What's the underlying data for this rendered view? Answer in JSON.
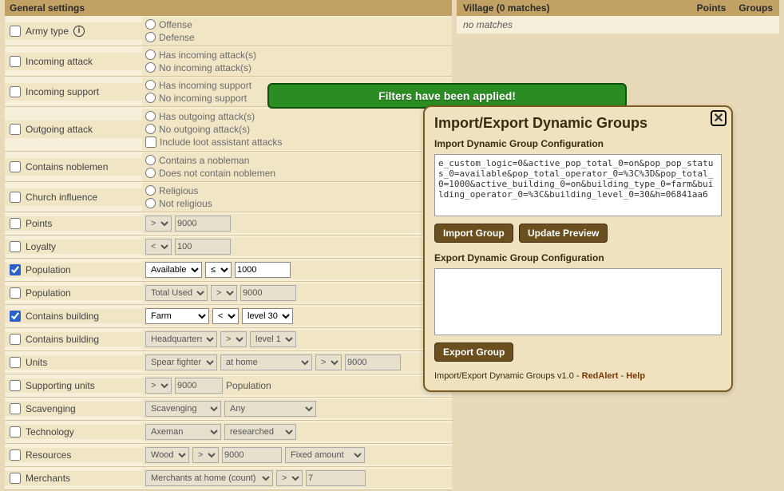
{
  "header": {
    "general_settings": "General settings"
  },
  "villages": {
    "col_village": "Village (0 matches)",
    "col_points": "Points",
    "col_groups": "Groups",
    "no_matches": "no matches"
  },
  "filters": {
    "army_type": {
      "label": "Army type",
      "offense": "Offense",
      "defense": "Defense"
    },
    "incoming_attack": {
      "label": "Incoming attack",
      "o1": "Has incoming attack(s)",
      "o2": "No incoming attack(s)"
    },
    "incoming_support": {
      "label": "Incoming support",
      "o1": "Has incoming support",
      "o2": "No incoming support"
    },
    "outgoing_attack": {
      "label": "Outgoing attack",
      "o1": "Has outgoing attack(s)",
      "o2": "No outgoing attack(s)",
      "o3": "Include loot assistant attacks"
    },
    "contains_noblemen": {
      "label": "Contains noblemen",
      "o1": "Contains a nobleman",
      "o2": "Does not contain noblemen"
    },
    "church_influence": {
      "label": "Church influence",
      "o1": "Religious",
      "o2": "Not religious"
    },
    "points": {
      "label": "Points",
      "op": ">",
      "val": "9000"
    },
    "loyalty": {
      "label": "Loyalty",
      "op": "<",
      "val": "100"
    },
    "population1": {
      "label": "Population",
      "sel": "Available",
      "op": "≤",
      "val": "1000"
    },
    "population2": {
      "label": "Population",
      "sel": "Total Used",
      "op": ">",
      "val": "9000"
    },
    "building1": {
      "label": "Contains building",
      "sel": "Farm",
      "op": "<",
      "lvl": "level 30"
    },
    "building2": {
      "label": "Contains building",
      "sel": "Headquarters",
      "op": ">",
      "lvl": "level 1"
    },
    "units": {
      "label": "Units",
      "sel": "Spear fighter",
      "where": "at home",
      "op": ">",
      "val": "9000"
    },
    "supporting": {
      "label": "Supporting units",
      "op": ">",
      "val": "9000",
      "suffix": "Population"
    },
    "scavenging": {
      "label": "Scavenging",
      "sel": "Scavenging",
      "where": "Any"
    },
    "technology": {
      "label": "Technology",
      "sel": "Axeman",
      "where": "researched"
    },
    "resources": {
      "label": "Resources",
      "sel": "Wood",
      "op": ">",
      "val": "9000",
      "mode": "Fixed amount"
    },
    "merchants": {
      "label": "Merchants",
      "sel": "Merchants at home (count)",
      "op": ">",
      "val": "7"
    }
  },
  "toast": {
    "text": "Filters have been applied!"
  },
  "modal": {
    "title": "Import/Export Dynamic Groups",
    "import_heading": "Import Dynamic Group Configuration",
    "import_value": "e_custom_logic=0&active_pop_total_0=on&pop_pop_status_0=available&pop_total_operator_0=%3C%3D&pop_total_0=1000&active_building_0=on&building_type_0=farm&building_operator_0=%3C&building_level_0=30&h=06841aa6",
    "btn_import": "Import Group",
    "btn_update": "Update Preview",
    "export_heading": "Export Dynamic Group Configuration",
    "btn_export": "Export Group",
    "footer_text": "Import/Export Dynamic Groups v1.0 - ",
    "footer_author": "RedAlert",
    "footer_sep": " - ",
    "footer_help": "Help"
  }
}
